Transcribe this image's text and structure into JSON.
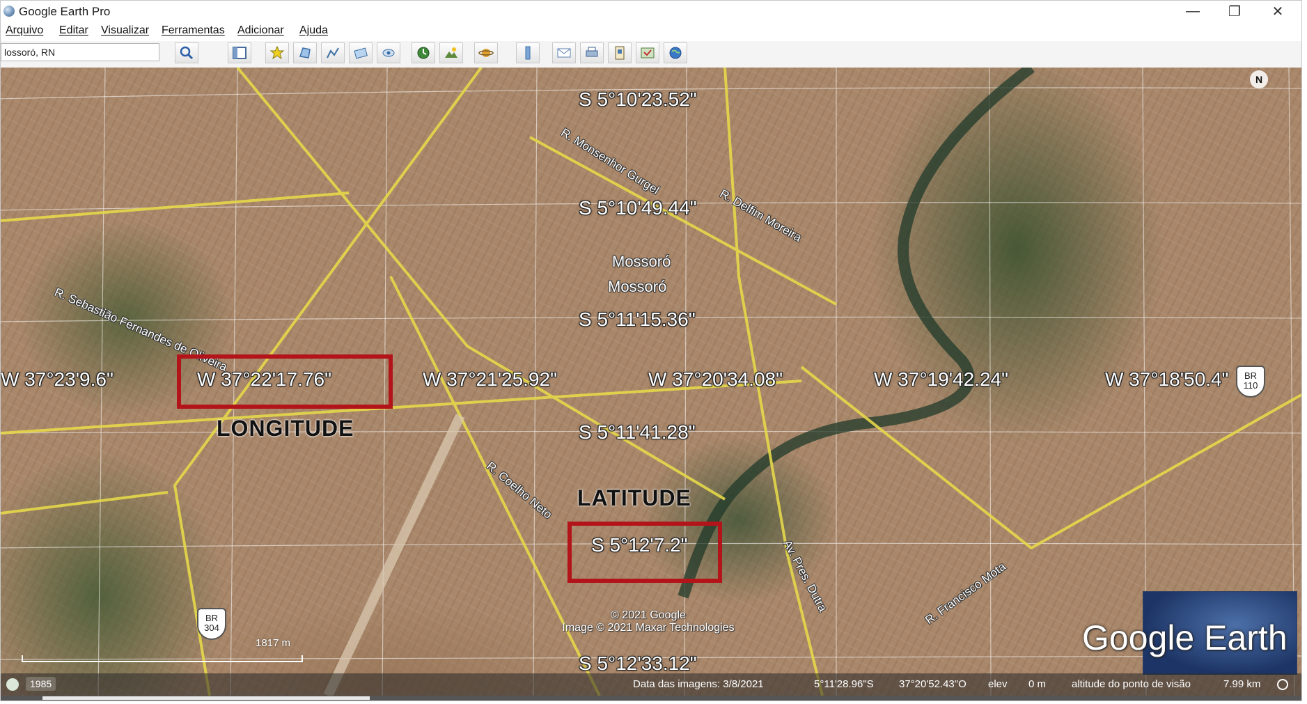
{
  "window": {
    "title": "Google Earth Pro",
    "minimize_glyph": "—",
    "restore_glyph": "❐",
    "close_glyph": "✕"
  },
  "menu": {
    "items": [
      "Arquivo",
      "Editar",
      "Visualizar",
      "Ferramentas",
      "Adicionar",
      "Ajuda"
    ]
  },
  "toolbar": {
    "search_value": "lossoró, RN",
    "buttons": [
      "search-icon",
      "sidebar-icon",
      "placemark-icon",
      "polygon-icon",
      "path-icon",
      "image-overlay-icon",
      "tour-icon",
      "historical-imagery-icon",
      "sunlight-icon",
      "planets-icon",
      "ruler-icon",
      "email-icon",
      "print-icon",
      "save-image-icon",
      "maps-icon",
      "earth-icon"
    ]
  },
  "map": {
    "latitude_labels": [
      "S 5°10'23.52\"",
      "S 5°10'49.44\"",
      "S 5°11'15.36\"",
      "S 5°11'41.28\"",
      "S 5°12'7.2\"",
      "S 5°12'33.12\""
    ],
    "longitude_labels": [
      "W 37°23'9.6\"",
      "W 37°22'17.76\"",
      "W 37°21'25.92\"",
      "W 37°20'34.08\"",
      "W 37°19'42.24\"",
      "W 37°18'50.4\""
    ],
    "city_labels": [
      "Mossoró",
      "Mossoró"
    ],
    "street_labels": [
      "R. Monsenhor Gurgel",
      "R. Delfim Moreira",
      "R. Sebastião Fernandes de Oliveira",
      "R. Coelho Neto",
      "Av. Pres. Dutra",
      "R. Francisco Mota"
    ],
    "annotations": {
      "longitude": "LONGITUDE",
      "latitude": "LATITUDE"
    },
    "highway_shield_1": {
      "line1": "BR",
      "line2": "304"
    },
    "highway_shield_2": {
      "line1": "BR",
      "line2": "110"
    },
    "north_label": "N",
    "scale_label": "1817 m",
    "copyright_lines": [
      "© 2021 Google",
      "Image © 2021 Maxar Technologies"
    ],
    "brand": "Google Earth"
  },
  "status": {
    "year": "1985",
    "imagery_date": "Data das imagens: 3/8/2021",
    "latitude": "5°11'28.96\"S",
    "longitude": "37°20'52.43\"O",
    "elev_label": "elev",
    "elev_value": "0 m",
    "eye_alt_label": "altitude do ponto de visão",
    "eye_alt_value": "7.99 km"
  },
  "colors": {
    "highlight_box": "#b3141a",
    "road": "#e5d84a"
  }
}
